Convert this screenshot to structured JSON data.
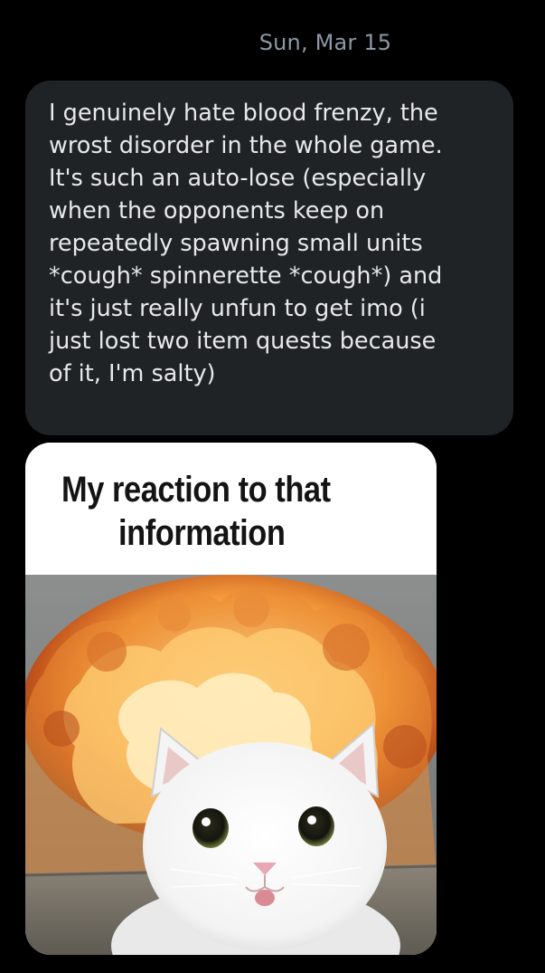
{
  "conversation": {
    "date_divider": "Sun, Mar 15",
    "message": {
      "lines": [
        "I genuinely hate blood frenzy, the",
        "wrost disorder in the whole game.",
        "It's such an auto-lose (especially",
        "when the opponents keep on",
        "repeatedly spawning small units",
        "*cough* spinnerette *cough*) and",
        "it's just really unfun to get imo (i",
        "just lost two item quests because",
        "of it, I'm salty)"
      ]
    },
    "attachment": {
      "caption_lines": [
        "My reaction to that",
        "information"
      ],
      "image_subject": "cat-in-front-of-explosion"
    }
  },
  "colors": {
    "background": "#000000",
    "bubble": "#1f2326",
    "text": "#e7e9ea",
    "muted": "#8b98a5"
  }
}
